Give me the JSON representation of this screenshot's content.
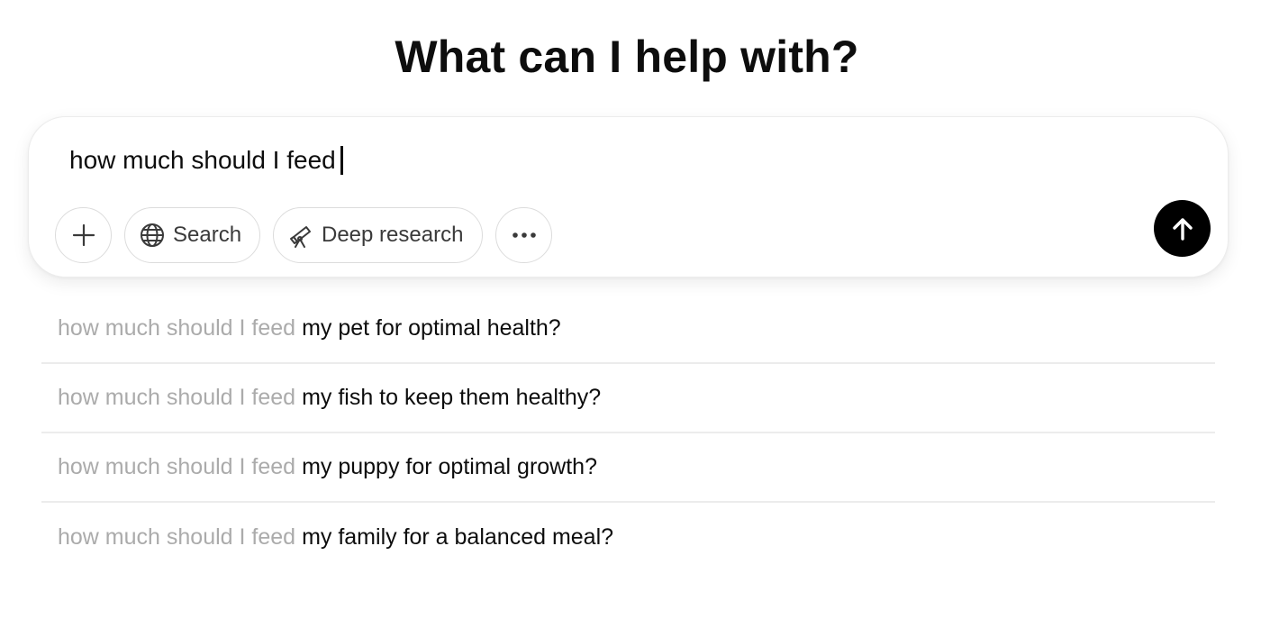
{
  "heading": "What can I help with?",
  "composer": {
    "input_value": "how much should I feed",
    "buttons": {
      "add_icon": "plus-icon",
      "search_label": "Search",
      "search_icon": "globe-icon",
      "deep_research_label": "Deep research",
      "deep_research_icon": "telescope-icon",
      "more_icon": "ellipsis-icon",
      "send_icon": "arrow-up-icon"
    }
  },
  "suggestions": [
    {
      "typed": "how much should I feed",
      "completion": "my pet for optimal health?"
    },
    {
      "typed": "how much should I feed",
      "completion": "my fish to keep them healthy?"
    },
    {
      "typed": "how much should I feed",
      "completion": "my puppy for optimal growth?"
    },
    {
      "typed": "how much should I feed",
      "completion": "my family for a balanced meal?"
    }
  ],
  "colors": {
    "send_button": "#000000",
    "typed_text": "#ababab",
    "divider": "#ececec"
  }
}
